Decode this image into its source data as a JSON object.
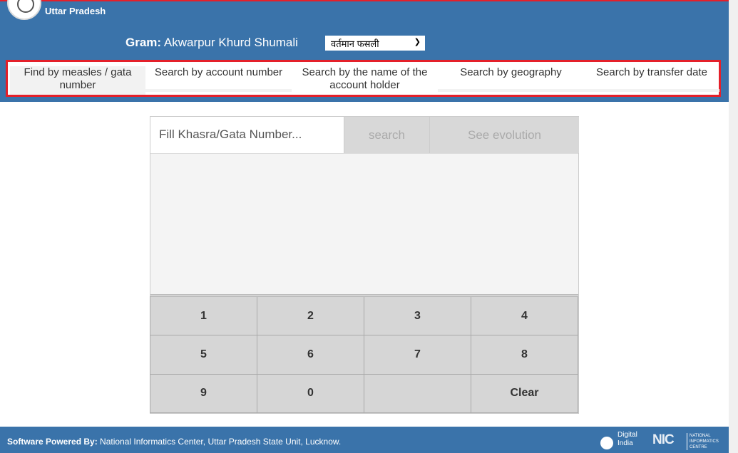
{
  "header": {
    "state": "Uttar Pradesh",
    "gram_label": "Gram:",
    "gram_name": "Akwarpur Khurd Shumali",
    "season": "वर्तमान फसली"
  },
  "tabs": [
    {
      "label": "Find by measles / gata number",
      "active": true
    },
    {
      "label": "Search by account number",
      "active": false
    },
    {
      "label": "Search by the name of the account holder",
      "active": false
    },
    {
      "label": "Search by geography",
      "active": false
    },
    {
      "label": "Search by transfer date",
      "active": false
    }
  ],
  "search": {
    "placeholder": "Fill Khasra/Gata Number...",
    "search_label": "search",
    "evolution_label": "See evolution"
  },
  "keypad": [
    "1",
    "2",
    "3",
    "4",
    "5",
    "6",
    "7",
    "8",
    "9",
    "0",
    "",
    "Clear"
  ],
  "footer": {
    "powered_label": "Software Powered By:",
    "powered_text": " National Informatics Center, Uttar Pradesh State Unit, Lucknow.",
    "digital_india": "Digital India",
    "nic": "NIC",
    "nic_full": "NATIONAL INFORMATICS CENTRE"
  },
  "colors": {
    "header": "#3a73aa",
    "highlight": "#e4202a"
  }
}
